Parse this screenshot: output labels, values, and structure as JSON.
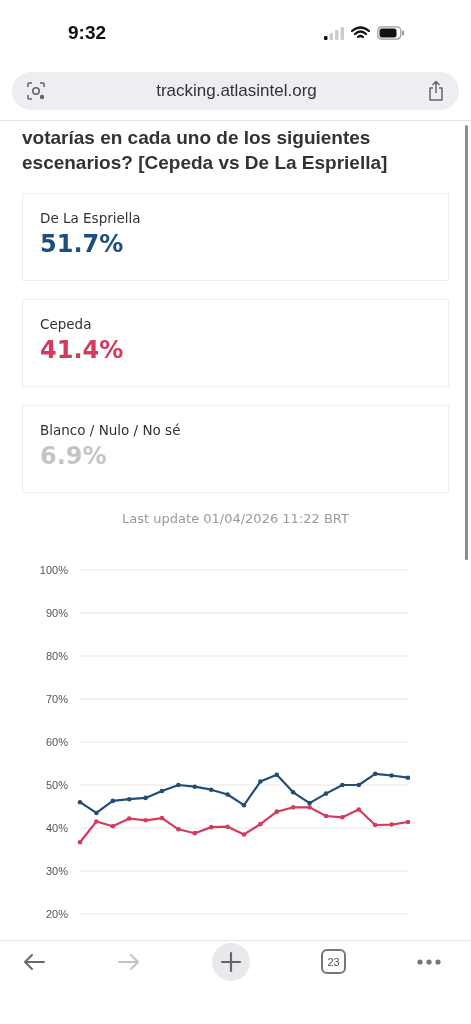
{
  "status_bar": {
    "time": "9:32"
  },
  "address_bar": {
    "url": "tracking.atlasintel.org"
  },
  "question": "votarías en cada uno de los siguientes escenarios? [Cepeda vs De La Espriella]",
  "results": [
    {
      "name": "De La Espriella",
      "value": "51.7%",
      "color": "#1d4f7c"
    },
    {
      "name": "Cepeda",
      "value": "41.4%",
      "color": "#d33a5c"
    },
    {
      "name": "Blanco / Nulo / No sé",
      "value": "6.9%",
      "color": "#c4c4c4"
    }
  ],
  "last_update": "Last update 01/04/2026 11:22 BRT",
  "chart": {
    "chart_data": {
      "type": "line",
      "grid": true,
      "ylim": [
        20,
        100
      ],
      "yticks": [
        {
          "value": 20,
          "label": "20%"
        },
        {
          "value": 30,
          "label": "30%"
        },
        {
          "value": 40,
          "label": "40%"
        },
        {
          "value": 50,
          "label": "50%"
        },
        {
          "value": 60,
          "label": "60%"
        },
        {
          "value": 70,
          "label": "70%"
        },
        {
          "value": 80,
          "label": "80%"
        },
        {
          "value": 90,
          "label": "90%"
        },
        {
          "value": 100,
          "label": "100%"
        }
      ],
      "series": [
        {
          "color": "#224d74",
          "values": [
            46,
            43.5,
            46.3,
            46.7,
            47,
            48.6,
            50,
            49.6,
            48.9,
            47.8,
            45.3,
            50.8,
            52.4,
            48.3,
            45.8,
            48,
            50,
            50,
            52.6,
            52.2,
            51.7
          ]
        },
        {
          "color": "#d63a5e",
          "values": [
            36.7,
            41.5,
            40.4,
            42.2,
            41.8,
            42.3,
            39.7,
            38.8,
            40.2,
            40.3,
            38.5,
            40.9,
            43.8,
            44.8,
            44.8,
            42.8,
            42.5,
            44.3,
            40.7,
            40.8,
            41.4
          ]
        }
      ]
    }
  },
  "toolbar": {
    "buttons": [
      {
        "kind": "back",
        "disabled": false
      },
      {
        "kind": "forward",
        "disabled": true
      },
      {
        "kind": "new_tab"
      },
      {
        "kind": "tabs",
        "label": "23"
      },
      {
        "kind": "more"
      }
    ]
  }
}
